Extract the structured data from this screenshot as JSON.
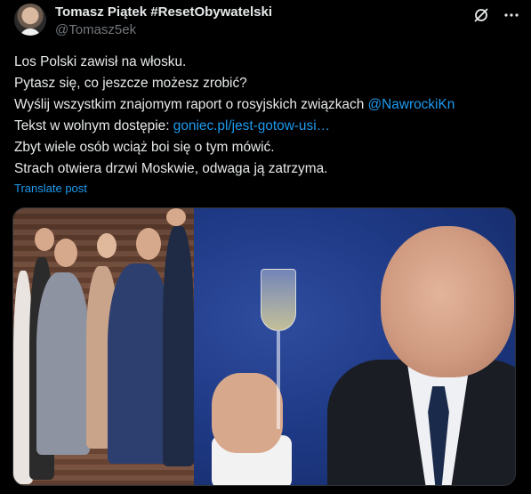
{
  "header": {
    "author_name": "Tomasz Piątek #ResetObywatelski",
    "author_handle": "@Tomasz5ek"
  },
  "tweet": {
    "line1": "Los Polski zawisł na włosku.",
    "line2": "Pytasz się, co jeszcze możesz zrobić?",
    "line3_prefix": "Wyślij wszystkim znajomym raport o rosyjskich związkach ",
    "line3_mention": "@NawrockiKn",
    "line4_prefix": "Tekst w wolnym dostępie: ",
    "line4_link": "goniec.pl/jest-gotow-usi…",
    "line5": "Zbyt wiele osób wciąż boi się o tym mówić.",
    "line6": "Strach otwiera drzwi Moskwie, odwaga ją zatrzyma.",
    "translate_label": "Translate post"
  },
  "icons": {
    "grok": "grok-icon",
    "more": "more-icon"
  },
  "colors": {
    "background": "#000000",
    "text": "#e7e9ea",
    "muted": "#71767b",
    "link": "#1d9bf0"
  }
}
